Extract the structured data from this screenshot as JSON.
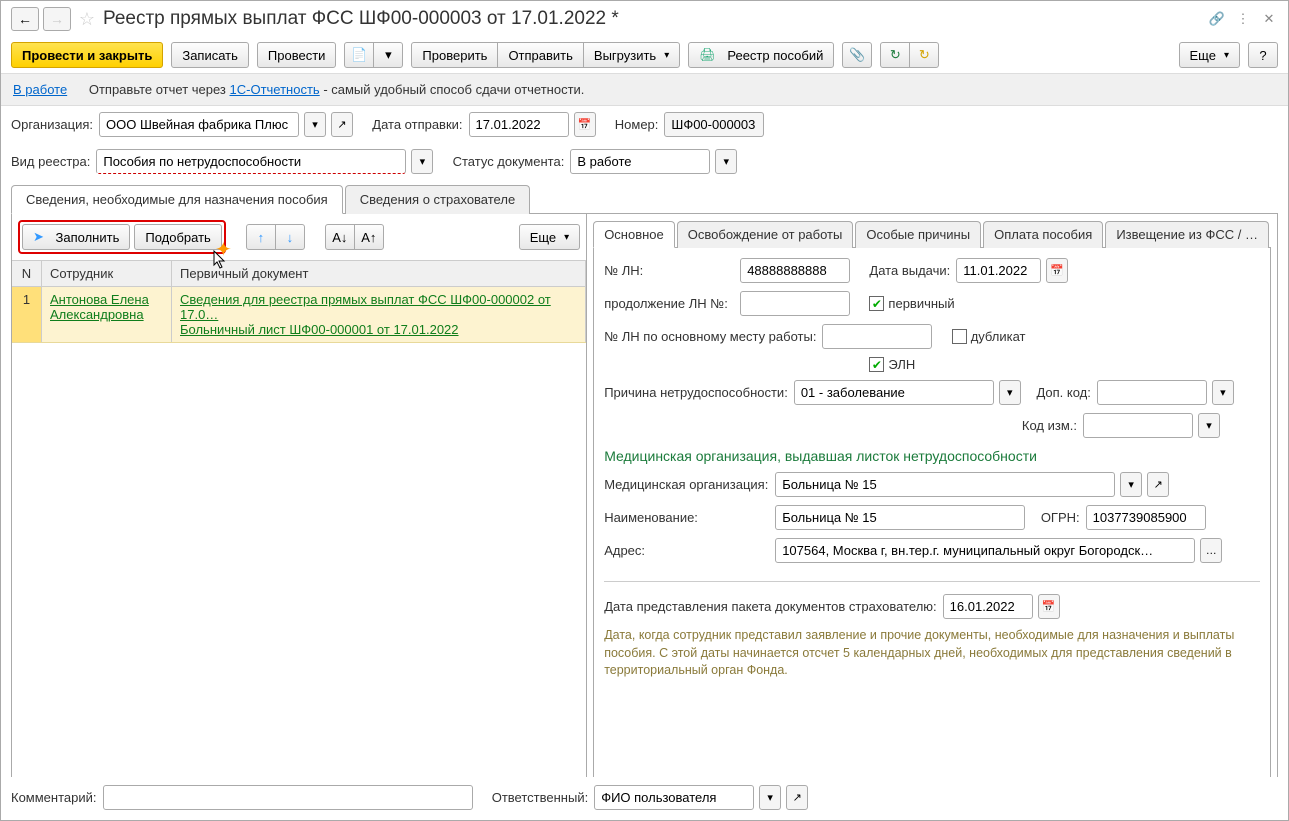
{
  "title": "Реестр прямых выплат ФСС ШФ00-000003 от 17.01.2022 *",
  "toolbar": {
    "post_close": "Провести и закрыть",
    "save": "Записать",
    "post": "Провести",
    "check": "Проверить",
    "send": "Отправить",
    "export": "Выгрузить",
    "registry": "Реестр пособий",
    "more": "Еще"
  },
  "status": {
    "link": "В работе",
    "prefix": "Отправьте отчет через ",
    "service": "1С-Отчетность",
    "suffix": " - самый удобный способ сдачи отчетности."
  },
  "header": {
    "org_label": "Организация:",
    "org_value": "ООО Швейная фабрика Плюс",
    "send_date_label": "Дата отправки:",
    "send_date_value": "17.01.2022",
    "number_label": "Номер:",
    "number_value": "ШФ00-000003",
    "reg_type_label": "Вид реестра:",
    "reg_type_value": "Пособия по нетрудоспособности",
    "doc_status_label": "Статус документа:",
    "doc_status_value": "В работе"
  },
  "tabs": {
    "t1": "Сведения, необходимые для назначения пособия",
    "t2": "Сведения о страхователе"
  },
  "left": {
    "fill": "Заполнить",
    "pick": "Подобрать",
    "more": "Еще",
    "col_n": "N",
    "col_emp": "Сотрудник",
    "col_doc": "Первичный документ",
    "rows": [
      {
        "n": "1",
        "emp": "Антонова Елена Александровна",
        "doc1": "Сведения для реестра прямых выплат ФСС ШФ00-000002 от 17.0…",
        "doc2": "Больничный лист ШФ00-000001 от 17.01.2022"
      }
    ]
  },
  "right_tabs": {
    "t1": "Основное",
    "t2": "Освобождение от работы",
    "t3": "Особые причины",
    "t4": "Оплата пособия",
    "t5": "Извещение из ФСС / …"
  },
  "detail": {
    "ln_no_label": "№ ЛН:",
    "ln_no_value": "48888888888",
    "issue_date_label": "Дата выдачи:",
    "issue_date_value": "11.01.2022",
    "cont_ln_label": "продолжение ЛН №:",
    "cont_ln_value": "",
    "primary_label": "первичный",
    "ln_main_label": "№ ЛН по основному месту работы:",
    "ln_main_value": "",
    "dup_label": "дубликат",
    "eln_label": "ЭЛН",
    "reason_label": "Причина нетрудоспособности:",
    "reason_value": "01 - заболевание",
    "addcode_label": "Доп. код:",
    "addcode_value": "",
    "chgcode_label": "Код изм.:",
    "chgcode_value": "",
    "med_section": "Медицинская организация, выдавшая листок нетрудоспособности",
    "med_org_label": "Медицинская организация:",
    "med_org_value": "Больница № 15",
    "med_name_label": "Наименование:",
    "med_name_value": "Больница № 15",
    "ogrn_label": "ОГРН:",
    "ogrn_value": "1037739085900",
    "addr_label": "Адрес:",
    "addr_value": "107564, Москва г, вн.тер.г. муниципальный округ Богородск…",
    "submit_date_label": "Дата представления пакета документов страхователю:",
    "submit_date_value": "16.01.2022",
    "hint": "Дата, когда сотрудник представил заявление и прочие документы, необходимые для назначения и выплаты пособия. С этой даты начинается отсчет 5 календарных дней, необходимых для представления сведений в территориальный орган Фонда."
  },
  "footer": {
    "comment_label": "Комментарий:",
    "comment_value": "",
    "resp_label": "Ответственный:",
    "resp_value": "ФИО пользователя"
  }
}
